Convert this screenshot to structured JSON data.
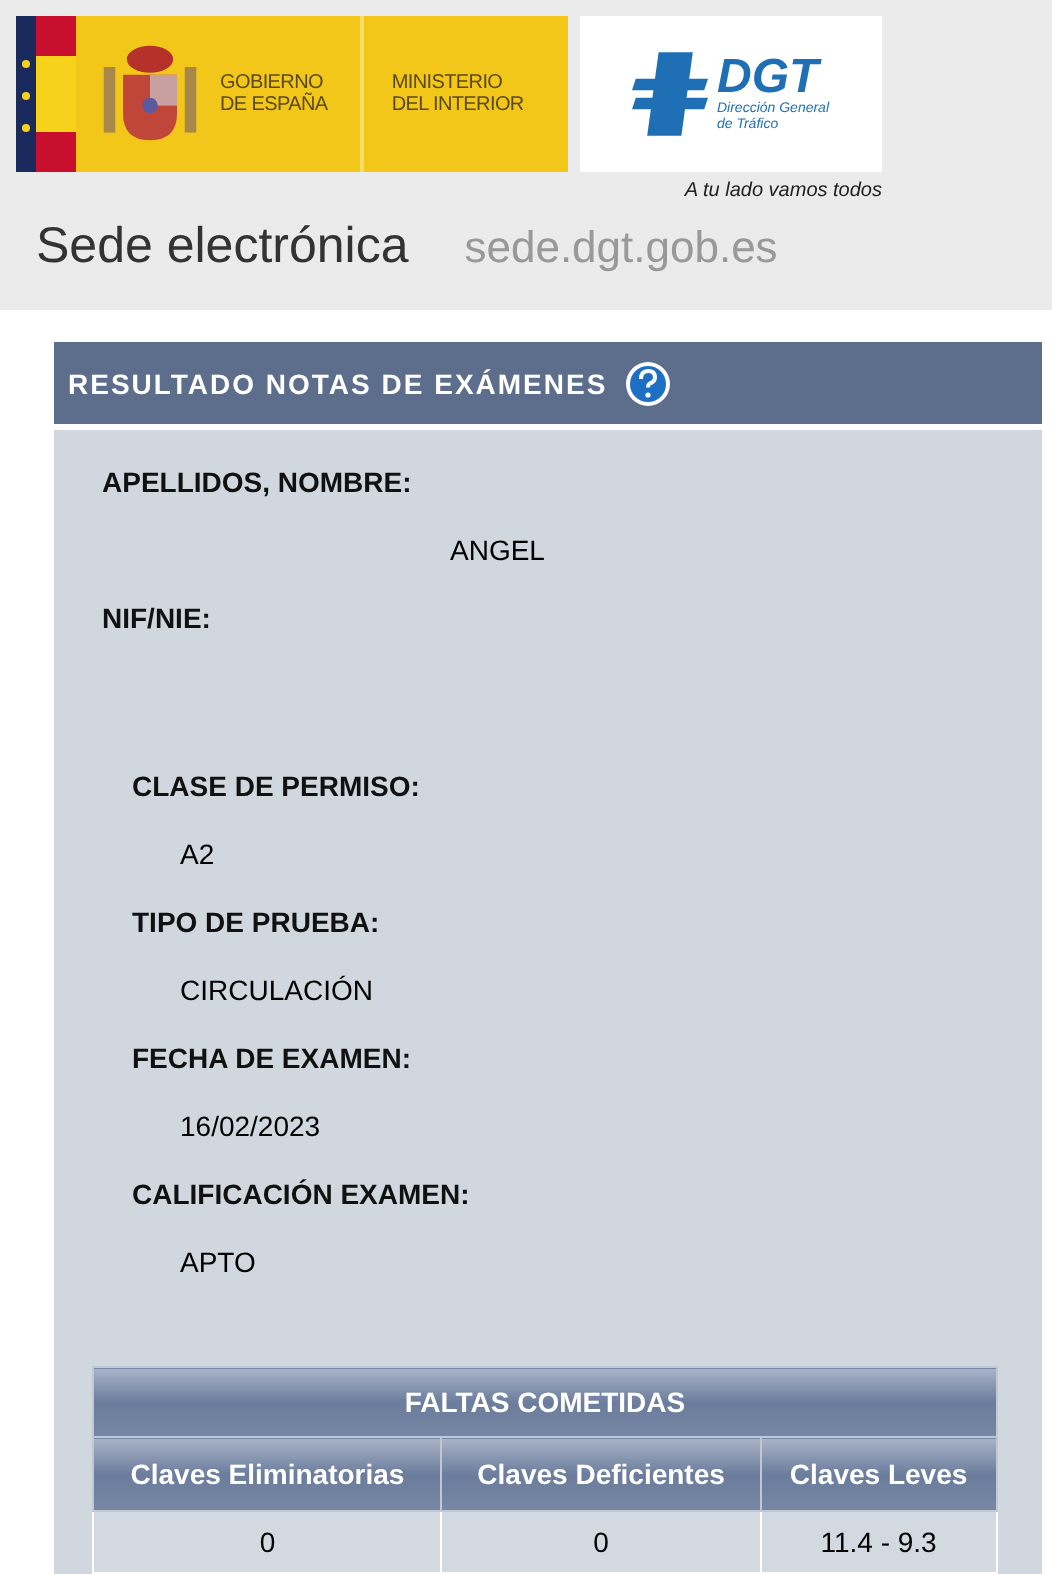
{
  "header": {
    "gov_line1": "GOBIERNO",
    "gov_line2": "DE ESPAÑA",
    "ministry_line1": "MINISTERIO",
    "ministry_line2": "DEL INTERIOR",
    "agency": "DGT",
    "agency_line1": "Dirección General",
    "agency_line2": "de Tráfico",
    "slogan": "A tu lado vamos todos",
    "site_title": "Sede electrónica",
    "site_url": "sede.dgt.gob.es"
  },
  "panel": {
    "title": "RESULTADO NOTAS DE EXÁMENES",
    "person": [
      {
        "label": "APELLIDOS, NOMBRE:",
        "value": "ANGEL"
      },
      {
        "label": "NIF/NIE:"
      }
    ],
    "exam": [
      {
        "label": "CLASE DE PERMISO:",
        "value": "A2"
      },
      {
        "label": "TIPO DE PRUEBA:",
        "value": "CIRCULACIÓN"
      },
      {
        "label": "FECHA DE EXAMEN:",
        "value": "16/02/2023"
      },
      {
        "label": "CALIFICACIÓN EXAMEN:",
        "value": "APTO"
      }
    ],
    "table": {
      "title": "FALTAS COMETIDAS",
      "columns": [
        "Claves Eliminatorias",
        "Claves Deficientes",
        "Claves Leves"
      ],
      "rows": [
        [
          "0",
          "0",
          "11.4 - 9.3"
        ]
      ]
    }
  }
}
